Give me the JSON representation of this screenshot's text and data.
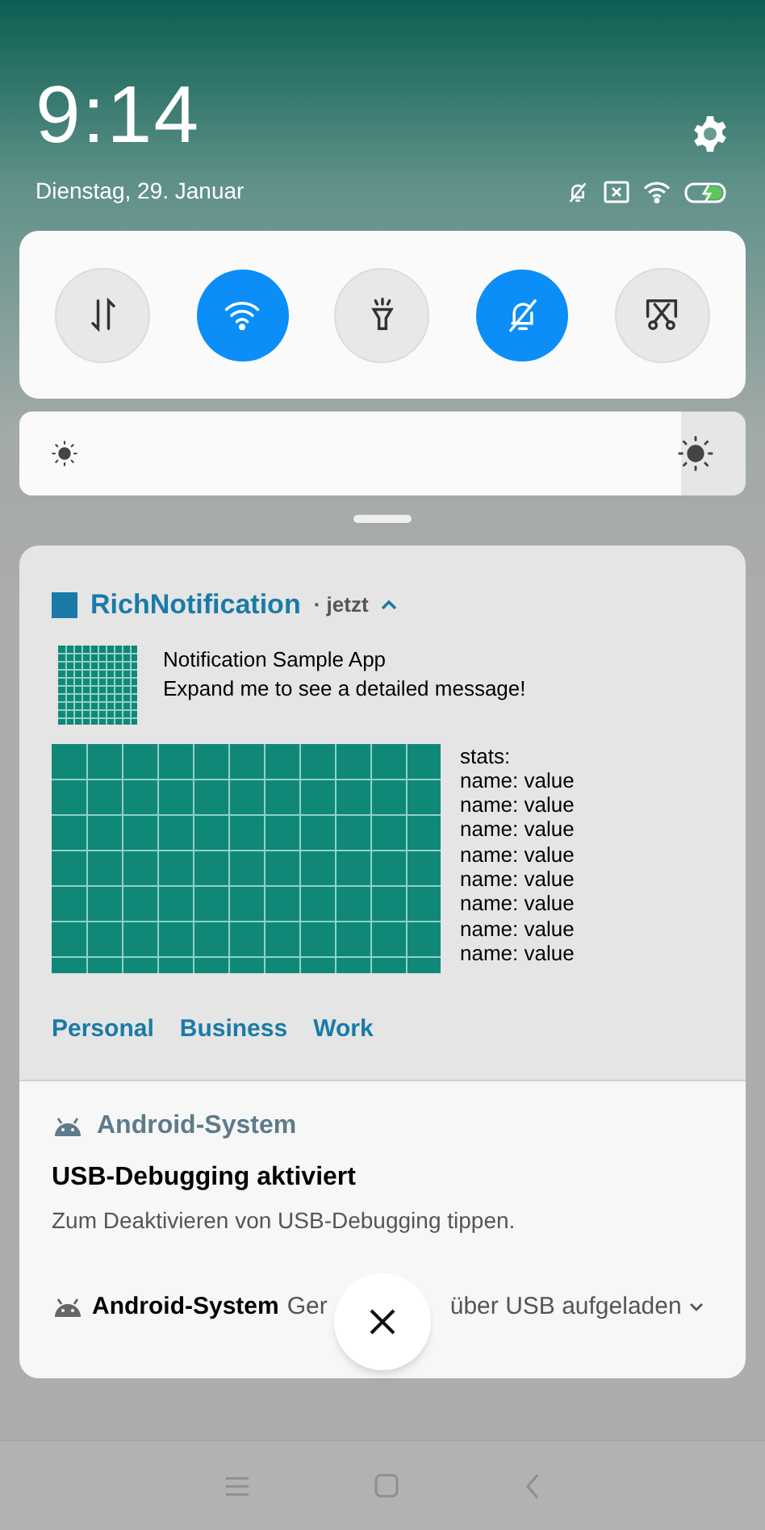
{
  "clock": {
    "time": "9:14",
    "date": "Dienstag, 29. Januar"
  },
  "quick_toggles": [
    {
      "kind": "data",
      "on": false
    },
    {
      "kind": "wifi",
      "on": true
    },
    {
      "kind": "flashlight",
      "on": false
    },
    {
      "kind": "silent",
      "on": true
    },
    {
      "kind": "screenshot",
      "on": false
    }
  ],
  "brightness": {
    "level": 0.91
  },
  "notifications": [
    {
      "kind": "rich",
      "app": "RichNotification",
      "time": "· jetzt",
      "expanded": true,
      "title": "Notification Sample App",
      "text": "Expand me to see a detailed message!",
      "stats": [
        "stats:",
        "name:  value",
        "name: value",
        "name: value",
        "name: value",
        "name: value",
        "name: value",
        "name: value",
        "name: value"
      ],
      "actions": [
        "Personal",
        "Business",
        "Work"
      ]
    },
    {
      "kind": "system",
      "app": "Android-System",
      "title": "USB-Debugging aktiviert",
      "text": "Zum Deaktivieren von USB-Debugging tippen."
    },
    {
      "kind": "collapsed",
      "app": "Android-System",
      "text_before": "Ger",
      "text_after": "über USB aufgeladen",
      "expanded": false
    }
  ]
}
